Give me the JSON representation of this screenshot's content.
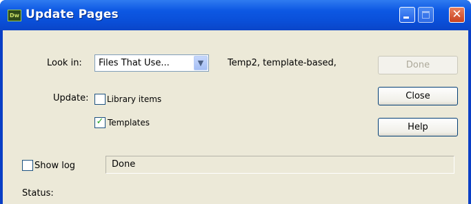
{
  "window": {
    "title": "Update Pages",
    "app_icon_text": "Dw"
  },
  "look_in": {
    "label": "Look in:",
    "selected": "Files That Use...",
    "description": "Temp2, template-based,"
  },
  "update": {
    "label": "Update:",
    "library_items": {
      "label": "Library items",
      "checked": false
    },
    "templates": {
      "label": "Templates",
      "checked": true
    }
  },
  "buttons": {
    "done": "Done",
    "close": "Close",
    "help": "Help"
  },
  "show_log": {
    "label": "Show log",
    "checked": false
  },
  "log_value": "Done",
  "status_label": "Status:"
}
